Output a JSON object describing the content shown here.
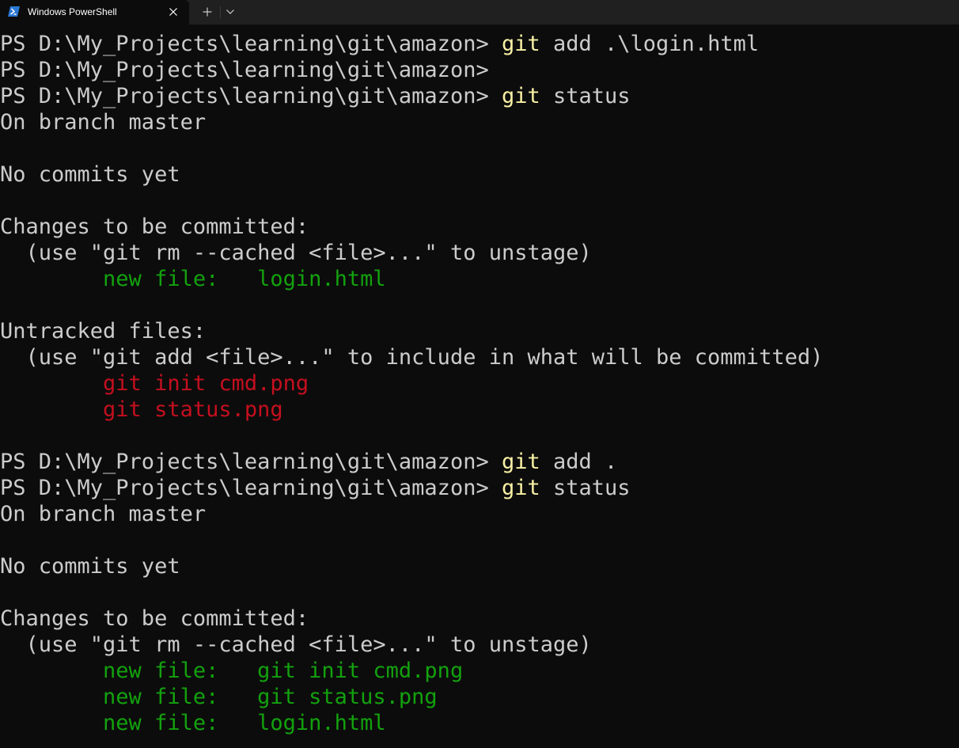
{
  "titlebar": {
    "tab_title": "Windows PowerShell"
  },
  "icons": {
    "tab_icon": "powershell-icon",
    "close": "close-icon",
    "new_tab": "plus-icon",
    "dropdown": "chevron-down-icon"
  },
  "colors": {
    "background": "#0c0c0c",
    "text": "#cccccc",
    "command": "#f9f1a5",
    "staged": "#13a10e",
    "untracked": "#c50f1f"
  },
  "lines": [
    {
      "type": "prompt",
      "prompt": "PS D:\\My_Projects\\learning\\git\\amazon> ",
      "command": "git",
      "args": " add .\\login.html"
    },
    {
      "type": "prompt",
      "prompt": "PS D:\\My_Projects\\learning\\git\\amazon>",
      "command": "",
      "args": ""
    },
    {
      "type": "prompt",
      "prompt": "PS D:\\My_Projects\\learning\\git\\amazon> ",
      "command": "git",
      "args": " status"
    },
    {
      "type": "text",
      "text": "On branch master"
    },
    {
      "type": "text",
      "text": ""
    },
    {
      "type": "text",
      "text": "No commits yet"
    },
    {
      "type": "text",
      "text": ""
    },
    {
      "type": "text",
      "text": "Changes to be committed:"
    },
    {
      "type": "text",
      "text": "  (use \"git rm --cached <file>...\" to unstage)"
    },
    {
      "type": "staged",
      "text": "        new file:   login.html"
    },
    {
      "type": "text",
      "text": ""
    },
    {
      "type": "text",
      "text": "Untracked files:"
    },
    {
      "type": "text",
      "text": "  (use \"git add <file>...\" to include in what will be committed)"
    },
    {
      "type": "untracked",
      "text": "        git init cmd.png"
    },
    {
      "type": "untracked",
      "text": "        git status.png"
    },
    {
      "type": "text",
      "text": ""
    },
    {
      "type": "prompt",
      "prompt": "PS D:\\My_Projects\\learning\\git\\amazon> ",
      "command": "git",
      "args": " add ."
    },
    {
      "type": "prompt",
      "prompt": "PS D:\\My_Projects\\learning\\git\\amazon> ",
      "command": "git",
      "args": " status"
    },
    {
      "type": "text",
      "text": "On branch master"
    },
    {
      "type": "text",
      "text": ""
    },
    {
      "type": "text",
      "text": "No commits yet"
    },
    {
      "type": "text",
      "text": ""
    },
    {
      "type": "text",
      "text": "Changes to be committed:"
    },
    {
      "type": "text",
      "text": "  (use \"git rm --cached <file>...\" to unstage)"
    },
    {
      "type": "staged",
      "text": "        new file:   git init cmd.png"
    },
    {
      "type": "staged",
      "text": "        new file:   git status.png"
    },
    {
      "type": "staged",
      "text": "        new file:   login.html"
    }
  ]
}
